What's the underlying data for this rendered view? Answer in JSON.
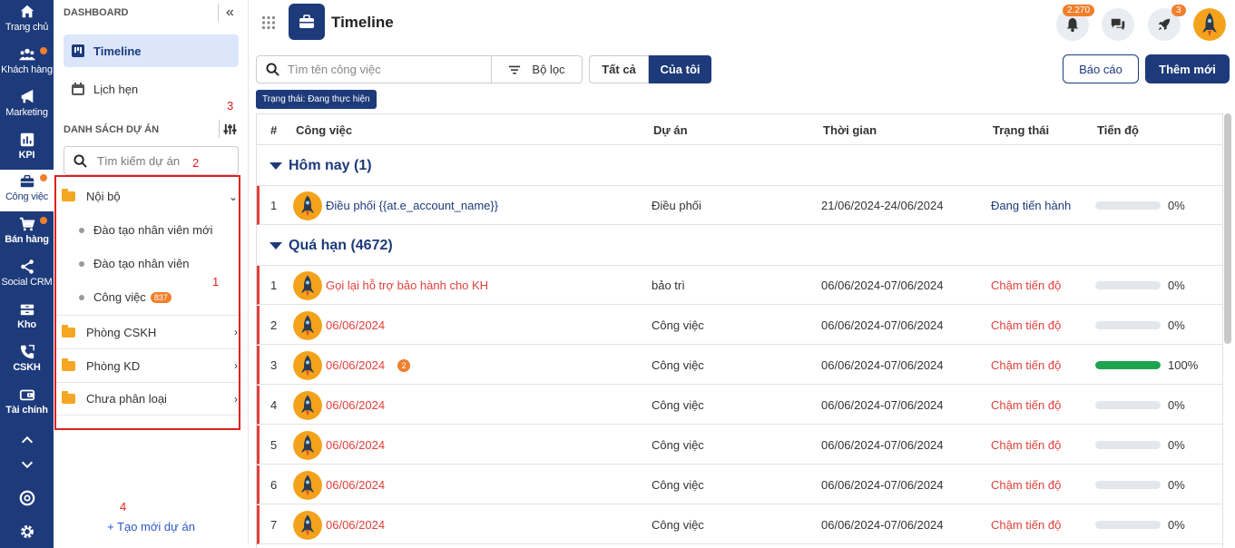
{
  "rail": {
    "items": [
      {
        "label": "Trang chủ",
        "icon": "home-icon",
        "dot": false
      },
      {
        "label": "Khách hàng",
        "icon": "users-icon",
        "dot": true
      },
      {
        "label": "Marketing",
        "icon": "megaphone-icon",
        "dot": false
      },
      {
        "label": "KPI",
        "icon": "chart-icon",
        "dot": false
      },
      {
        "label": "Công việc",
        "icon": "briefcase-icon",
        "dot": true,
        "active": true
      },
      {
        "label": "Bán hàng",
        "icon": "cart-icon",
        "dot": true
      },
      {
        "label": "Social CRM",
        "icon": "share-icon",
        "dot": false
      },
      {
        "label": "Kho",
        "icon": "warehouse-icon",
        "dot": false
      },
      {
        "label": "CSKH",
        "icon": "phone-icon",
        "dot": false
      },
      {
        "label": "Tài chính",
        "icon": "finance-icon",
        "dot": false
      }
    ]
  },
  "panel": {
    "header": "DASHBOARD",
    "nav": [
      {
        "label": "Timeline",
        "active": true
      },
      {
        "label": "Lịch hẹn",
        "active": false
      }
    ],
    "projects_header": "DANH SÁCH DỰ ÁN",
    "search_placeholder": "Tìm kiếm dự án",
    "annotations": [
      "1",
      "2",
      "3",
      "4"
    ],
    "tree": {
      "root": "Nội bộ",
      "children": [
        {
          "label": "Đào tạo nhân viên mới"
        },
        {
          "label": "Đào tạo nhân viên"
        },
        {
          "label": "Công việc",
          "count": "837"
        }
      ],
      "others": [
        "Phòng CSKH",
        "Phòng KD",
        "Chưa phân loại"
      ]
    },
    "new_project": "+ Tạo mới dự án"
  },
  "header": {
    "title": "Timeline",
    "notif_badge": "2.270",
    "rocket_badge": "3"
  },
  "toolbar": {
    "search_placeholder": "Tìm tên công việc",
    "filter_label": "Bộ lọc",
    "seg_all": "Tất cả",
    "seg_mine": "Của tôi",
    "report_label": "Báo cáo",
    "add_label": "Thêm mới",
    "status_chip": "Trạng thái: Đang thực hiện"
  },
  "table": {
    "columns": [
      "#",
      "Công việc",
      "Dự án",
      "Thời gian",
      "Trạng thái",
      "Tiến độ"
    ],
    "groups": [
      {
        "title": "Hôm nay (1)",
        "rows": [
          {
            "no": "1",
            "task": "Điều phối {{at.e_account_name}}",
            "project": "Điều phối",
            "time": "21/06/2024-24/06/2024",
            "status": "Đang tiến hành",
            "progress": 0,
            "progress_label": "0%",
            "late": false
          }
        ]
      },
      {
        "title": "Quá hạn (4672)",
        "rows": [
          {
            "no": "1",
            "task": "Gọi lại hỗ trợ bảo hành cho KH",
            "project": "bảo trì",
            "time": "06/06/2024-07/06/2024",
            "status": "Chậm tiến độ",
            "progress": 0,
            "progress_label": "0%",
            "late": true
          },
          {
            "no": "2",
            "task": "06/06/2024",
            "project": "Công việc",
            "time": "06/06/2024-07/06/2024",
            "status": "Chậm tiến độ",
            "progress": 0,
            "progress_label": "0%",
            "late": true
          },
          {
            "no": "3",
            "task": "06/06/2024",
            "project": "Công việc",
            "time": "06/06/2024-07/06/2024",
            "status": "Chậm tiến độ",
            "progress": 100,
            "progress_label": "100%",
            "late": true,
            "badge": "2"
          },
          {
            "no": "4",
            "task": "06/06/2024",
            "project": "Công việc",
            "time": "06/06/2024-07/06/2024",
            "status": "Chậm tiến độ",
            "progress": 0,
            "progress_label": "0%",
            "late": true
          },
          {
            "no": "5",
            "task": "06/06/2024",
            "project": "Công việc",
            "time": "06/06/2024-07/06/2024",
            "status": "Chậm tiến độ",
            "progress": 0,
            "progress_label": "0%",
            "late": true
          },
          {
            "no": "6",
            "task": "06/06/2024",
            "project": "Công việc",
            "time": "06/06/2024-07/06/2024",
            "status": "Chậm tiến độ",
            "progress": 0,
            "progress_label": "0%",
            "late": true
          },
          {
            "no": "7",
            "task": "06/06/2024",
            "project": "Công việc",
            "time": "06/06/2024-07/06/2024",
            "status": "Chậm tiến độ",
            "progress": 0,
            "progress_label": "0%",
            "late": true
          }
        ]
      }
    ]
  },
  "colors": {
    "brand": "#1d3a7a",
    "accent": "#f07f2c",
    "late": "#e0403a",
    "progress": "#1ea34f"
  }
}
